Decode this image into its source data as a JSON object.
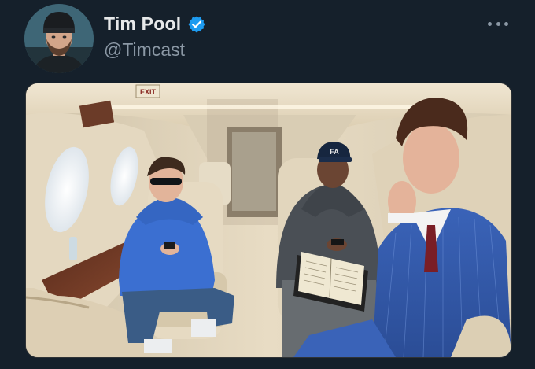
{
  "tweet": {
    "author": {
      "display_name": "Tim Pool",
      "handle": "@Timcast",
      "verified": true,
      "verified_icon": "verified-badge-icon",
      "avatar_icon": "avatar"
    },
    "more_icon": "more-options-icon",
    "media": {
      "kind": "photo",
      "sign_text": "EXIT",
      "cap_text": "FA"
    }
  },
  "colors": {
    "background": "#15202b",
    "name": "#e7e9ea",
    "handle": "#8b98a5",
    "verified": "#1d9bf0"
  }
}
